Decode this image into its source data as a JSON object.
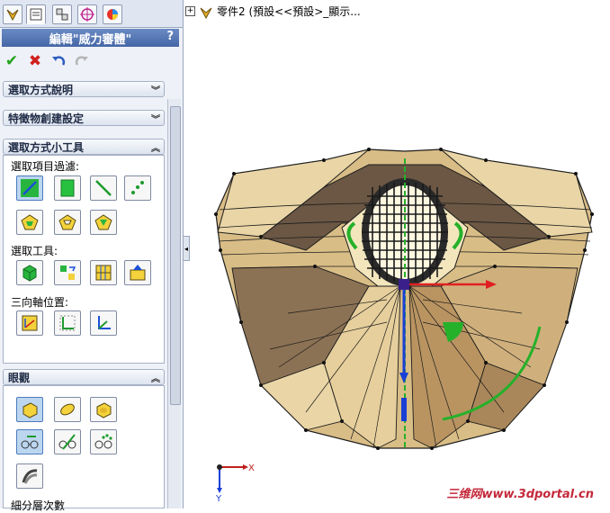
{
  "left_panel": {
    "tabs": [
      {
        "name": "feature-manager-tab",
        "icon": "feature-tree-icon"
      },
      {
        "name": "property-manager-tab",
        "icon": "property-manager-icon"
      },
      {
        "name": "configuration-manager-tab",
        "icon": "configuration-icon"
      },
      {
        "name": "dimxpert-tab",
        "icon": "target-icon"
      },
      {
        "name": "display-manager-tab",
        "icon": "appearance-icon"
      }
    ],
    "title": "編輯\"威力審體\"",
    "help": "?",
    "sections": {
      "selection_help": "選取方式說明",
      "feature_settings": "特徵物創建設定",
      "selection_tools": "選取方式小工具",
      "view": "眼觀"
    },
    "labels": {
      "filter": "選取項目過濾:",
      "tools": "選取工具:",
      "triad": "三向軸位置:",
      "subdivision": "細分層次數"
    }
  },
  "graphics": {
    "tree_item": "零件2 (預設<<預設>_顯示...",
    "axis_x": "X",
    "axis_y": "Y",
    "watermark": "三维网www.3dportal.cn"
  },
  "colors": {
    "model_light": "#e9d5a6",
    "model_mid": "#c9a977",
    "model_dark": "#6b5744",
    "edge": "#1c1c1c",
    "x_axis": "#e02020",
    "y_axis": "#1a3fd6",
    "ring": "#25b12a"
  }
}
